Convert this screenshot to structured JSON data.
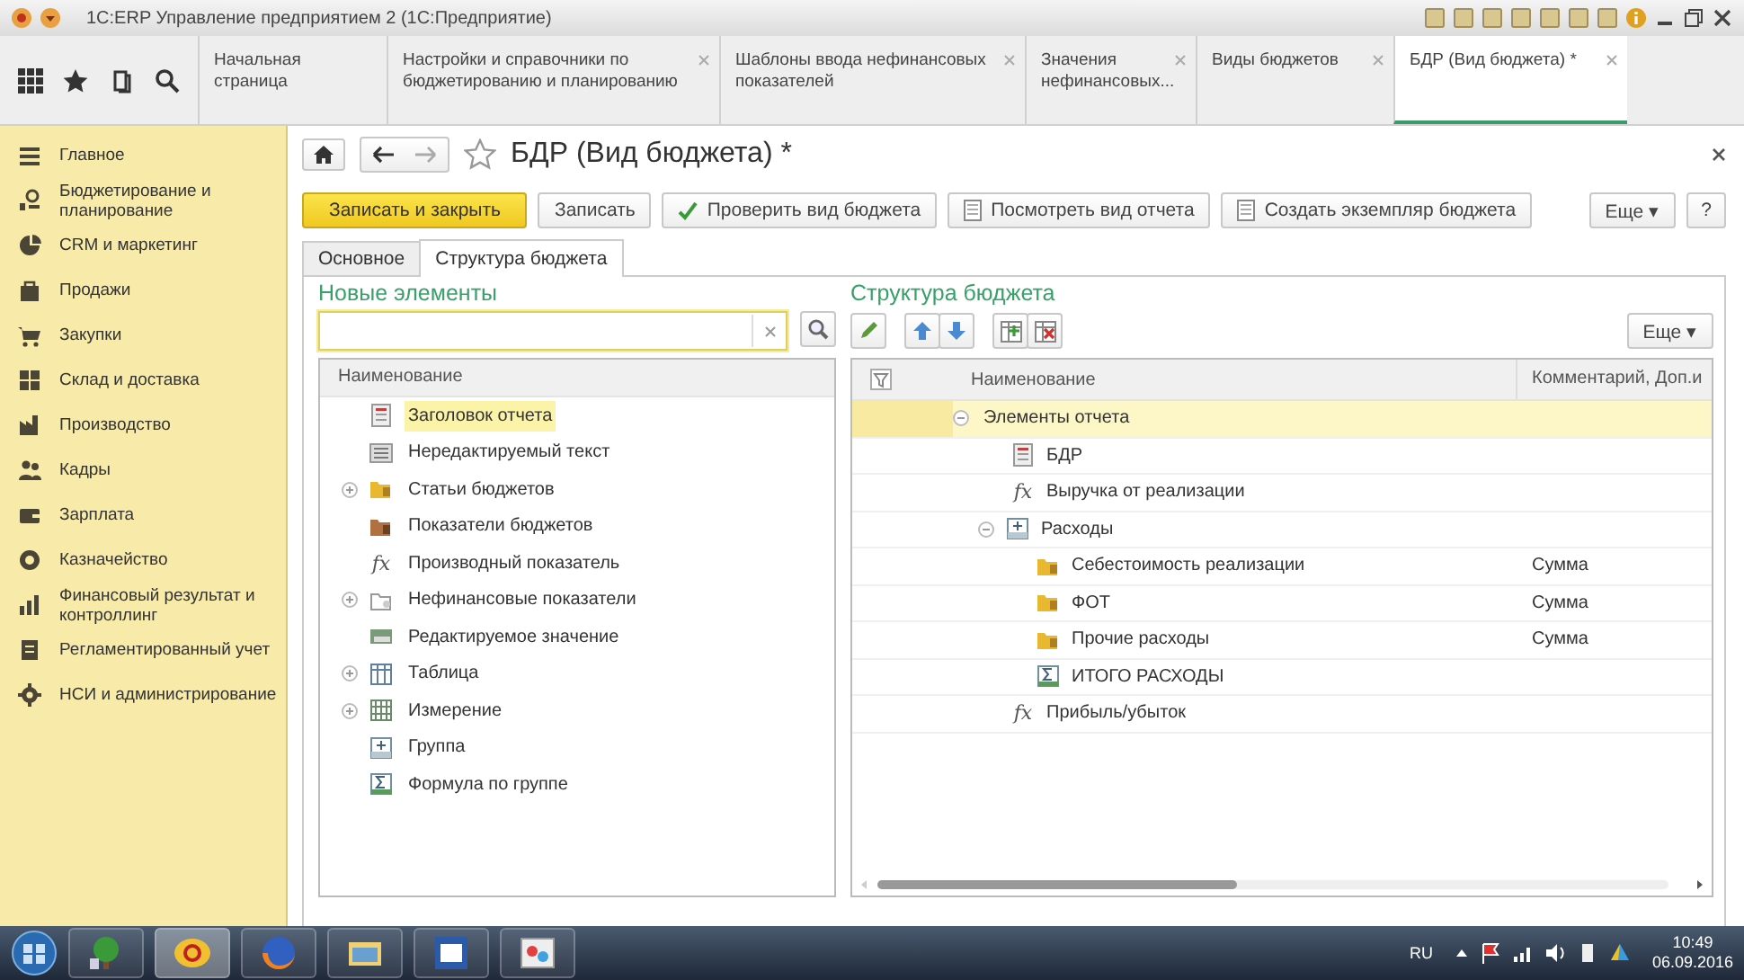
{
  "window": {
    "title": "1С:ERP Управление предприятием 2  (1С:Предприятие)"
  },
  "open_tabs": [
    {
      "label": "Начальная страница",
      "closable": false,
      "selected": false
    },
    {
      "label": "Настройки и справочники по бюджетированию и планированию",
      "closable": true,
      "selected": false
    },
    {
      "label": "Шаблоны ввода нефинансовых показателей",
      "closable": true,
      "selected": false
    },
    {
      "label": "Значения нефинансовых...",
      "closable": true,
      "selected": false
    },
    {
      "label": "Виды  бюджетов",
      "closable": true,
      "selected": false
    },
    {
      "label": "БДР (Вид бюджета) *",
      "closable": true,
      "selected": true
    }
  ],
  "sidebar": {
    "items": [
      {
        "label": "Главное",
        "kind": "menu"
      },
      {
        "label": "Бюджетирование и планирование",
        "kind": "budget"
      },
      {
        "label": "CRM и маркетинг",
        "kind": "pie"
      },
      {
        "label": "Продажи",
        "kind": "bag"
      },
      {
        "label": "Закупки",
        "kind": "cart"
      },
      {
        "label": "Склад и доставка",
        "kind": "grid"
      },
      {
        "label": "Производство",
        "kind": "factory"
      },
      {
        "label": "Кадры",
        "kind": "people"
      },
      {
        "label": "Зарплата",
        "kind": "wallet"
      },
      {
        "label": "Казначейство",
        "kind": "coin"
      },
      {
        "label": "Финансовый результат и контроллинг",
        "kind": "bars"
      },
      {
        "label": "Регламентированный учет",
        "kind": "doc"
      },
      {
        "label": "НСИ и администрирование",
        "kind": "gear"
      }
    ]
  },
  "form": {
    "title": "БДР (Вид бюджета) *",
    "buttons": [
      {
        "label": "Записать и закрыть",
        "kind": "primary"
      },
      {
        "label": "Записать",
        "kind": "plain"
      },
      {
        "label": "Проверить вид бюджета",
        "kind": "check"
      },
      {
        "label": "Посмотреть вид отчета",
        "kind": "doc"
      },
      {
        "label": "Создать экземпляр бюджета",
        "kind": "doc"
      }
    ],
    "more_button": "Еще ▾",
    "help_button": "?",
    "tabs": [
      {
        "label": "Основное",
        "selected": false
      },
      {
        "label": "Структура бюджета",
        "selected": true
      }
    ]
  },
  "new_elements": {
    "heading": "Новые элементы",
    "column": "Наименование",
    "items": [
      {
        "label": "Заголовок отчета",
        "kind": "header-doc",
        "expander": false,
        "selected": true
      },
      {
        "label": "Нередактируемый текст",
        "kind": "text-lines",
        "expander": false,
        "selected": false
      },
      {
        "label": "Статьи бюджетов",
        "kind": "folder",
        "expander": true,
        "selected": false
      },
      {
        "label": "Показатели бюджетов",
        "kind": "indicators",
        "expander": false,
        "selected": false
      },
      {
        "label": "Производный показатель",
        "kind": "formula",
        "symbol": "fx",
        "expander": false,
        "selected": false
      },
      {
        "label": "Нефинансовые показатели",
        "kind": "nonfin",
        "expander": true,
        "selected": false
      },
      {
        "label": "Редактируемое значение",
        "kind": "edit-value",
        "expander": false,
        "selected": false
      },
      {
        "label": "Таблица",
        "kind": "table",
        "expander": true,
        "selected": false
      },
      {
        "label": "Измерение",
        "kind": "dimension",
        "expander": true,
        "selected": false
      },
      {
        "label": "Группа",
        "kind": "group",
        "expander": false,
        "selected": false
      },
      {
        "label": "Формула по группе",
        "kind": "group-formula",
        "expander": false,
        "selected": false
      }
    ]
  },
  "structure": {
    "heading": "Структура бюджета",
    "more_button": "Еще ▾",
    "columns": [
      "Наименование",
      "Комментарий, Доп.и"
    ],
    "rows": [
      {
        "label": "Элементы отчета",
        "selected": true,
        "expanded": true,
        "children": [
          {
            "label": "БДР",
            "kind": "header-doc",
            "selected": false
          },
          {
            "label": "Выручка от реализации",
            "kind": "formula",
            "symbol": "fx",
            "selected": false
          },
          {
            "label": "Расходы",
            "kind": "group",
            "selected": false,
            "expanded": true,
            "children": [
              {
                "label": "Себестоимость реализации",
                "kind": "folder",
                "comment": "Сумма",
                "selected": false
              },
              {
                "label": "ФОТ",
                "kind": "folder",
                "comment": "Сумма",
                "selected": false
              },
              {
                "label": "Прочие расходы",
                "kind": "folder",
                "comment": "Сумма",
                "selected": false
              },
              {
                "label": "ИТОГО РАСХОДЫ",
                "kind": "group-formula",
                "selected": false
              }
            ]
          },
          {
            "label": "Прибыль/убыток",
            "kind": "formula",
            "symbol": "fx",
            "selected": false
          }
        ]
      }
    ]
  },
  "taskbar": {
    "language": "RU",
    "time": "10:49",
    "date": "06.09.2016"
  }
}
